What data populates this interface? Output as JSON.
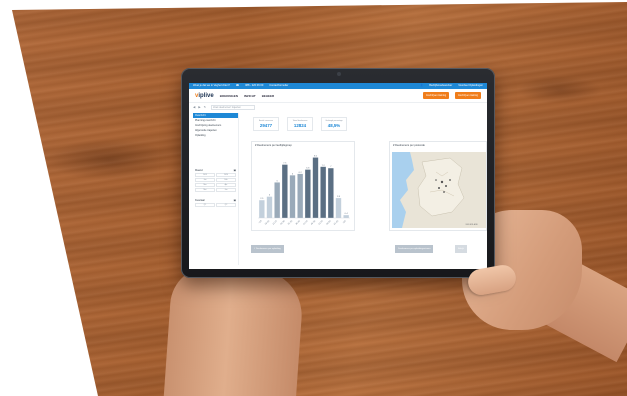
{
  "topbar": {
    "question": "Weet je dat we in Veghel zitten?",
    "phone": "088 - 220 06 00",
    "contact": "Contactformulier",
    "account": "Bedrijfsmedewerker",
    "partners": "Voordeel Opleidingen"
  },
  "nav": {
    "logo_v": "v",
    "logo_rest": "iplive",
    "links": [
      "BOEKINGEN",
      "INZICHT",
      "BEHEER"
    ],
    "button_1": "Inschrijven training",
    "button_2": "Inschrijven training"
  },
  "toolbar": {
    "search_placeholder": "Zoek deelnemer/ trajecten"
  },
  "sidebar": {
    "items": [
      "Overzicht",
      "Planning overzicht",
      "Inschrijving deelnemers",
      "Afgeronde trajecten",
      "Opleiding"
    ],
    "active_index": 0,
    "section_1": "Maand",
    "section_1_cells": [
      "2019",
      "2020",
      "Jan",
      "Feb",
      "Mar",
      "Apr",
      "Mei",
      "Jun"
    ],
    "section_2": "Kwartaal",
    "section_2_cells": [
      "Q1",
      "Q2"
    ]
  },
  "kpis": [
    {
      "label": "Aantal cursussen",
      "value": "29477"
    },
    {
      "label": "Totaal deelnemers",
      "value": "12824"
    },
    {
      "label": "Geslaagd percentage",
      "value": "48,5%"
    }
  ],
  "chart_panel": {
    "title": "# Deelnemers per leeftijdsgroep",
    "button": "# Deelnemers per opleiding"
  },
  "map_panel": {
    "title": "# Deelnemers per postcode",
    "map_credit": "NEDERLAND",
    "button": "Deelnemers per opleidingsniveau",
    "button_2": "Bekijk"
  },
  "colors": {
    "accent_blue": "#1e88d6",
    "accent_orange": "#f07d1a",
    "bar_light": "#c3d0dc",
    "bar_mid": "#9aaab9",
    "bar_dark": "#5b6f83"
  },
  "chart_data": {
    "type": "bar",
    "title": "# Deelnemers per leeftijdsgroep",
    "categories": [
      "<18",
      "18-20",
      "21-25",
      "26-30",
      "31-35",
      "36-40",
      "41-45",
      "46-50",
      "51-55",
      "56-60",
      "61-65",
      ">65"
    ],
    "values": [
      2.5,
      3.0,
      5.0,
      7.5,
      6.0,
      6.2,
      6.8,
      8.5,
      7.2,
      7.0,
      2.8,
      0.4
    ],
    "ylim": [
      0,
      9
    ],
    "grid": false,
    "legend": "none"
  }
}
